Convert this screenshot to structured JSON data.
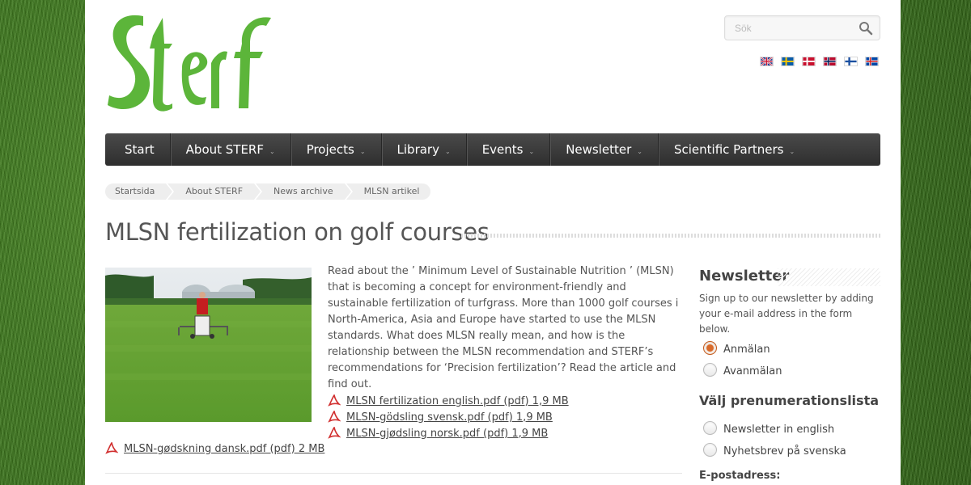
{
  "header": {
    "logo_text": "Sterf",
    "search_placeholder": "Sök",
    "languages": [
      {
        "name": "english-flag"
      },
      {
        "name": "swedish-flag"
      },
      {
        "name": "danish-flag"
      },
      {
        "name": "norwegian-flag"
      },
      {
        "name": "finnish-flag"
      },
      {
        "name": "icelandic-flag"
      }
    ]
  },
  "nav": {
    "items": [
      {
        "label": "Start",
        "dropdown": false
      },
      {
        "label": "About STERF",
        "dropdown": true
      },
      {
        "label": "Projects",
        "dropdown": true
      },
      {
        "label": "Library",
        "dropdown": true
      },
      {
        "label": "Events",
        "dropdown": true
      },
      {
        "label": "Newsletter",
        "dropdown": true
      },
      {
        "label": "Scientific Partners",
        "dropdown": true
      }
    ]
  },
  "breadcrumb": [
    "Startsida",
    "About STERF",
    "News archive",
    "MLSN artikel"
  ],
  "main": {
    "title": "MLSN fertilization on golf courses",
    "body": "Read about the ’ Minimum Level of Sustainable Nutrition ’ (MLSN) that is becoming a concept for environment-friendly and sustainable fertilization of turfgrass. More than 1000 golf courses i North-America, Asia and Europe have started to use the MLSN standards. What does MLSN really mean, and how is the relationship between the MLSN recommendation and STERF’s recommendations for ‘Precision fertilization’?  Read the article and find out.",
    "files": [
      "MLSN fertilization english.pdf (pdf) 1,9 MB",
      "MLSN-gödsling svensk.pdf (pdf) 1,9 MB",
      "MLSN-gjødsling norsk.pdf (pdf) 1,9 MB"
    ],
    "file_bottom": "MLSN-gødskning dansk.pdf (pdf) 2 MB"
  },
  "sidebar": {
    "title": "Newsletter",
    "description": "Sign up to our newsletter by adding your e-mail address in the form below.",
    "action_options": [
      "Anmälan",
      "Avanmälan"
    ],
    "selected_action": "Anmälan",
    "list_heading": "Välj prenumerationslista",
    "list_options": [
      "Newsletter in english",
      "Nyhetsbrev på svenska"
    ],
    "email_label": "E-postadress:"
  },
  "colors": {
    "logo_green": "#5cb53a",
    "nav_bg": "#3a3a3a",
    "radio_selected": "#d86a2a"
  }
}
